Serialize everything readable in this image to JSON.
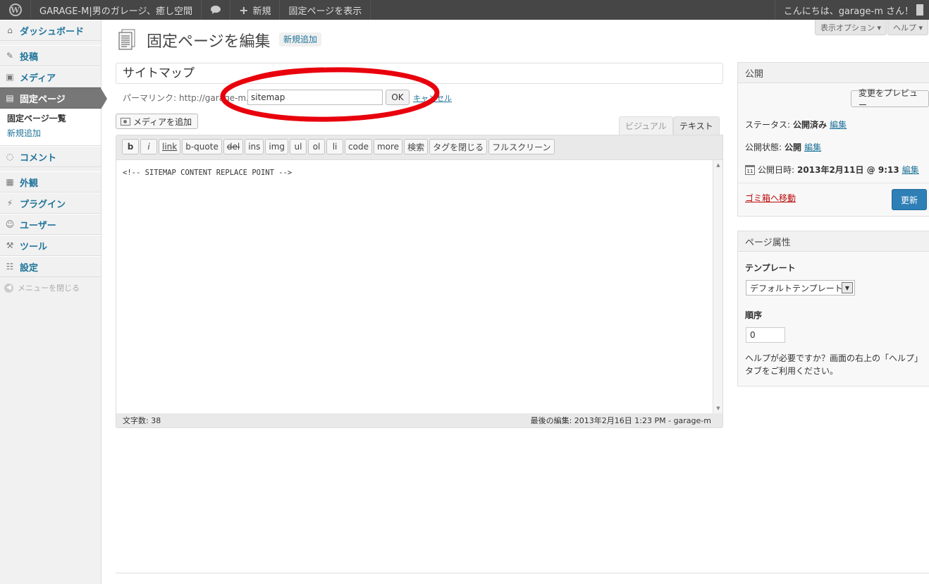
{
  "admin_bar": {
    "site_name": "GARAGE-M|男のガレージ、癒し空間",
    "new_label": "新規",
    "view_page": "固定ページを表示",
    "greeting": "こんにちは、garage-m さん！",
    "icons": {
      "logo": "wordpress-logo-icon",
      "comments": "comment-bubble-icon",
      "plus": "plus-icon"
    }
  },
  "sidebar": {
    "items": [
      {
        "label": "ダッシュボード",
        "icon": "dashboard-icon"
      },
      {
        "label": "投稿",
        "icon": "pin-icon"
      },
      {
        "label": "メディア",
        "icon": "media-icon"
      },
      {
        "label": "固定ページ",
        "icon": "pages-icon"
      },
      {
        "label": "コメント",
        "icon": "comment-icon"
      },
      {
        "label": "外観",
        "icon": "appearance-icon"
      },
      {
        "label": "プラグイン",
        "icon": "plugin-icon"
      },
      {
        "label": "ユーザー",
        "icon": "users-icon"
      },
      {
        "label": "ツール",
        "icon": "tools-icon"
      },
      {
        "label": "設定",
        "icon": "settings-icon"
      }
    ],
    "submenu": [
      "固定ページ一覧",
      "新規追加"
    ],
    "collapse": "メニューを閉じる"
  },
  "header": {
    "screen_options": "表示オプション ▾",
    "help": "ヘルプ ▾",
    "title": "固定ページを編集",
    "add_new": "新規追加"
  },
  "editor": {
    "post_title": "サイトマップ",
    "permalink_label": "パーマリンク:",
    "permalink_base": "http://garage-m.net/",
    "slug": "sitemap",
    "ok": "OK",
    "cancel": "キャンセル",
    "add_media": "メディアを追加",
    "tab_visual": "ビジュアル",
    "tab_text": "テキスト",
    "toolbar": [
      "b",
      "i",
      "link",
      "b-quote",
      "del",
      "ins",
      "img",
      "ul",
      "ol",
      "li",
      "code",
      "more",
      "検索",
      "タグを閉じる",
      "フルスクリーン"
    ],
    "content": "<!-- SITEMAP CONTENT REPLACE POINT -->",
    "word_count": "文字数: 38",
    "last_edit": "最後の編集: 2013年2月16日 1:23 PM - garage-m"
  },
  "publish_box": {
    "title": "公開",
    "preview": "変更をプレビュー",
    "status_label": "ステータス:",
    "status_value": "公開済み",
    "visibility_label": "公開状態:",
    "visibility_value": "公開",
    "date_label": "公開日時:",
    "date_value": "2013年2月11日 @ 9:13",
    "edit": "編集",
    "trash": "ゴミ箱へ移動",
    "update": "更新"
  },
  "attributes_box": {
    "title": "ページ属性",
    "template_label": "テンプレート",
    "template_value": "デフォルトテンプレート",
    "order_label": "順序",
    "order_value": "0",
    "help_text": "ヘルプが必要ですか？画面の右上の「ヘルプ」タブをご利用ください。"
  },
  "annotation_color": "#e8000c"
}
